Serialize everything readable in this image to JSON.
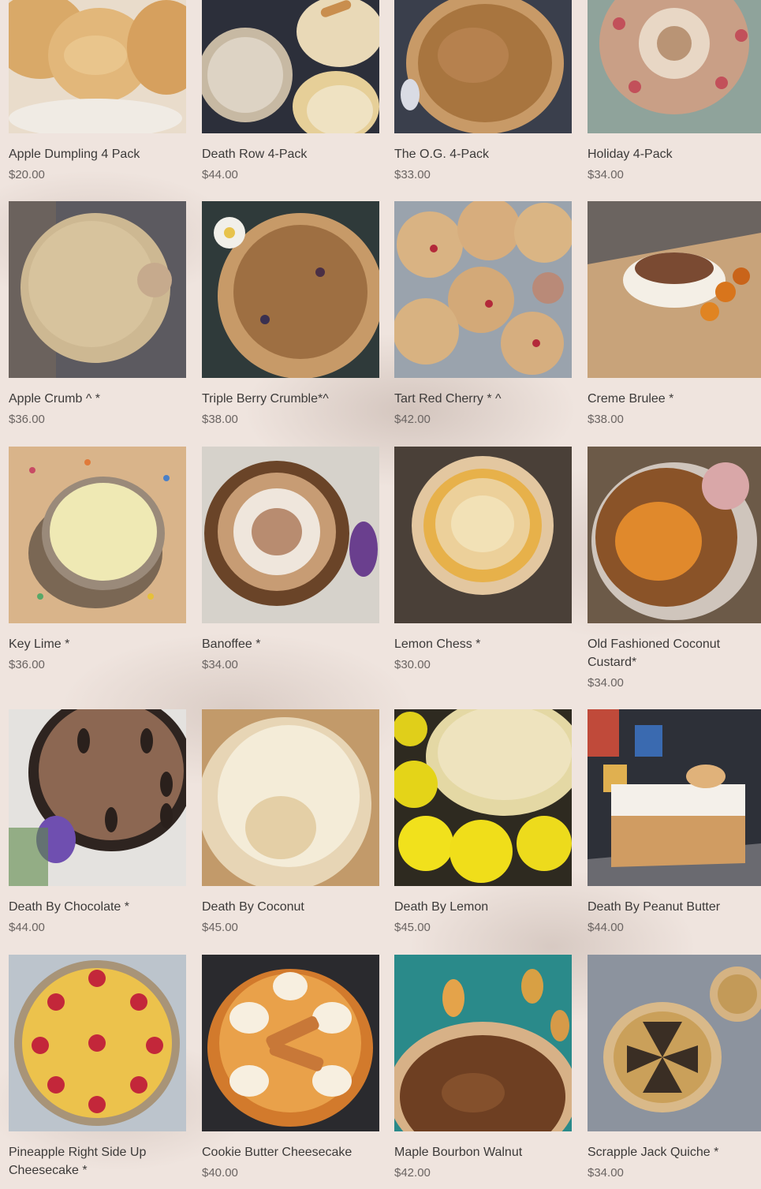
{
  "products": [
    {
      "title": "Apple Dumpling 4 Pack",
      "price": "$20.00",
      "image": "apple-dumpling-image"
    },
    {
      "title": "Death Row 4-Pack",
      "price": "$44.00",
      "image": "death-row-pack-image"
    },
    {
      "title": "The O.G. 4-Pack",
      "price": "$33.00",
      "image": "og-pack-image"
    },
    {
      "title": "Holiday 4-Pack",
      "price": "$34.00",
      "image": "holiday-pack-image"
    },
    {
      "title": "Apple Crumb ^ *",
      "price": "$36.00",
      "image": "apple-crumb-image"
    },
    {
      "title": "Triple Berry Crumble*^",
      "price": "$38.00",
      "image": "triple-berry-image"
    },
    {
      "title": "Tart Red Cherry * ^",
      "price": "$42.00",
      "image": "tart-cherry-image"
    },
    {
      "title": "Creme Brulee *",
      "price": "$38.00",
      "image": "creme-brulee-image"
    },
    {
      "title": "Key Lime *",
      "price": "$36.00",
      "image": "key-lime-image"
    },
    {
      "title": "Banoffee *",
      "price": "$34.00",
      "image": "banoffee-image"
    },
    {
      "title": "Lemon Chess *",
      "price": "$30.00",
      "image": "lemon-chess-image"
    },
    {
      "title": "Old Fashioned Coconut Custard*",
      "price": "$34.00",
      "image": "coconut-custard-image"
    },
    {
      "title": "Death By Chocolate *",
      "price": "$44.00",
      "image": "death-chocolate-image"
    },
    {
      "title": "Death By Coconut",
      "price": "$45.00",
      "image": "death-coconut-image"
    },
    {
      "title": "Death By Lemon",
      "price": "$45.00",
      "image": "death-lemon-image"
    },
    {
      "title": "Death By Peanut Butter",
      "price": "$44.00",
      "image": "death-peanut-butter-image"
    },
    {
      "title": "Pineapple Right Side Up Cheesecake *",
      "price": "",
      "image": "pineapple-cheesecake-image"
    },
    {
      "title": "Cookie Butter Cheesecake",
      "price": "$40.00",
      "image": "cookie-butter-image"
    },
    {
      "title": "Maple Bourbon Walnut",
      "price": "$42.00",
      "image": "maple-bourbon-image"
    },
    {
      "title": "Scrapple Jack Quiche *",
      "price": "$34.00",
      "image": "scrapple-quiche-image"
    }
  ],
  "colors": {
    "background": "#efe4de",
    "title_text": "#3c3a39",
    "price_text": "#6a6462"
  }
}
